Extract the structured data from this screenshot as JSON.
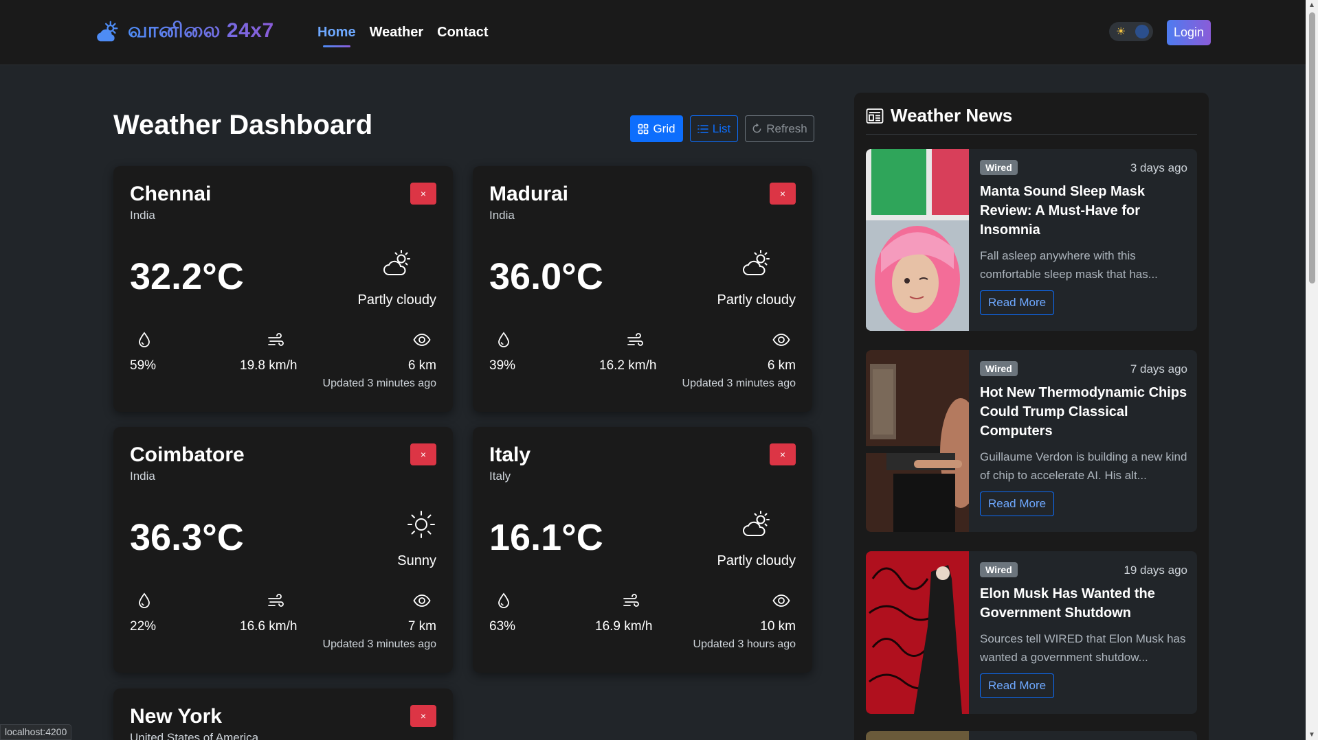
{
  "navbar": {
    "brand_icon": "cloud-sun-icon",
    "brand_text": "வானிலை 24x7",
    "links": [
      {
        "label": "Home",
        "active": true
      },
      {
        "label": "Weather",
        "active": false
      },
      {
        "label": "Contact",
        "active": false
      }
    ],
    "theme_toggle_icon": "sun-icon",
    "login_label": "Login"
  },
  "dashboard": {
    "title": "Weather Dashboard",
    "view_buttons": {
      "grid": "Grid",
      "list": "List",
      "refresh": "Refresh"
    },
    "close_label": "×",
    "cities": [
      {
        "city": "Chennai",
        "country": "India",
        "temp": "32.2°C",
        "condition": "Partly cloudy",
        "condition_icon": "cloud-sun-icon",
        "humidity": "59%",
        "wind": "19.8 km/h",
        "visibility": "6 km",
        "updated": "Updated 3 minutes ago"
      },
      {
        "city": "Madurai",
        "country": "India",
        "temp": "36.0°C",
        "condition": "Partly cloudy",
        "condition_icon": "cloud-sun-icon",
        "humidity": "39%",
        "wind": "16.2 km/h",
        "visibility": "6 km",
        "updated": "Updated 3 minutes ago"
      },
      {
        "city": "Coimbatore",
        "country": "India",
        "temp": "36.3°C",
        "condition": "Sunny",
        "condition_icon": "sun-icon",
        "humidity": "22%",
        "wind": "16.6 km/h",
        "visibility": "7 km",
        "updated": "Updated 3 minutes ago"
      },
      {
        "city": "Italy",
        "country": "Italy",
        "temp": "16.1°C",
        "condition": "Partly cloudy",
        "condition_icon": "cloud-sun-icon",
        "humidity": "63%",
        "wind": "16.9 km/h",
        "visibility": "10 km",
        "updated": "Updated 3 hours ago"
      },
      {
        "city": "New York",
        "country": "United States of America"
      }
    ]
  },
  "news": {
    "title": "Weather News",
    "read_more": "Read More",
    "items": [
      {
        "source": "Wired",
        "time": "3 days ago",
        "title": "Manta Sound Sleep Mask Review: A Must-Have for Insomnia",
        "desc": "Fall asleep anywhere with this comfortable sleep mask that has..."
      },
      {
        "source": "Wired",
        "time": "7 days ago",
        "title": "Hot New Thermodynamic Chips Could Trump Classical Computers",
        "desc": "Guillaume Verdon is building a new kind of chip to accelerate AI. His alt..."
      },
      {
        "source": "Wired",
        "time": "19 days ago",
        "title": "Elon Musk Has Wanted the Government Shutdown",
        "desc": "Sources tell WIRED that Elon Musk has wanted a government shutdow..."
      }
    ]
  },
  "status_bar": {
    "url": "localhost:4200"
  },
  "colors": {
    "background": "#212529",
    "card": "#1a1a1a",
    "primary": "#0d6efd",
    "danger": "#dc3545",
    "accent_gradient_start": "#4e8cf5",
    "accent_gradient_end": "#8a5cd8"
  }
}
